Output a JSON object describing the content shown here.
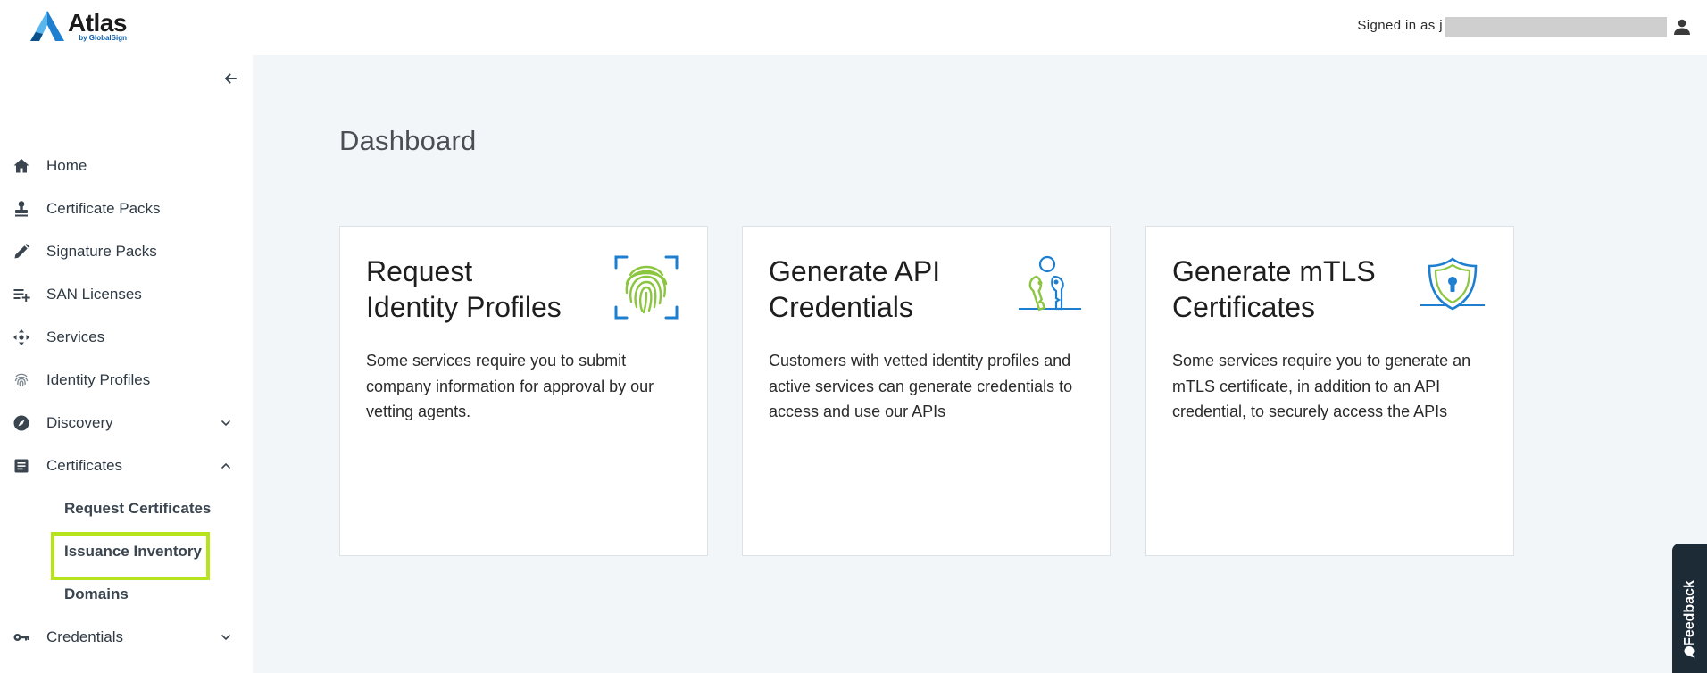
{
  "app": {
    "name": "Atlas",
    "by": "by GlobalSign"
  },
  "header": {
    "signed_in_label": "Signed in as j"
  },
  "sidebar": {
    "items": [
      {
        "label": "Home",
        "icon": "home-icon"
      },
      {
        "label": "Certificate Packs",
        "icon": "stamp-icon"
      },
      {
        "label": "Signature Packs",
        "icon": "pencil-icon"
      },
      {
        "label": "SAN Licenses",
        "icon": "playlist-add-icon"
      },
      {
        "label": "Services",
        "icon": "services-icon"
      },
      {
        "label": "Identity Profiles",
        "icon": "fingerprint-icon"
      },
      {
        "label": "Discovery",
        "icon": "compass-icon",
        "expandable": true,
        "expanded": false
      },
      {
        "label": "Certificates",
        "icon": "document-icon",
        "expandable": true,
        "expanded": true
      },
      {
        "label": "Credentials",
        "icon": "key-icon",
        "expandable": true,
        "expanded": false
      }
    ],
    "certificates_sub": [
      {
        "label": "Request Certificates"
      },
      {
        "label": "Issuance Inventory",
        "highlighted": true
      },
      {
        "label": "Domains"
      }
    ]
  },
  "main": {
    "title": "Dashboard",
    "cards": [
      {
        "title": "Request Identity Profiles",
        "title_line1": "Request",
        "title_line2": "Identity Profiles",
        "description": "Some services require you to submit company information for approval by our vetting agents.",
        "icon": "fingerprint-scan-icon"
      },
      {
        "title": "Generate API Credentials",
        "title_line1": "Generate API",
        "title_line2": "Credentials",
        "description": "Customers with vetted identity profiles and active services can generate credentials to access and use our APIs",
        "icon": "keys-icon"
      },
      {
        "title": "Generate mTLS Certificates",
        "title_line1": "Generate mTLS",
        "title_line2": "Certificates",
        "description": "Some services require you to generate an mTLS certificate, in addition to an API credential, to securely access the APIs",
        "icon": "shield-lock-icon"
      }
    ]
  },
  "feedback": {
    "label": "Feedback"
  },
  "colors": {
    "accent_highlight": "#b6e31c",
    "main_background": "#f2f6f8",
    "feedback_tab": "#1d2b37",
    "brand_blue": "#1e7fd0",
    "icon_green": "#8cc63f"
  }
}
